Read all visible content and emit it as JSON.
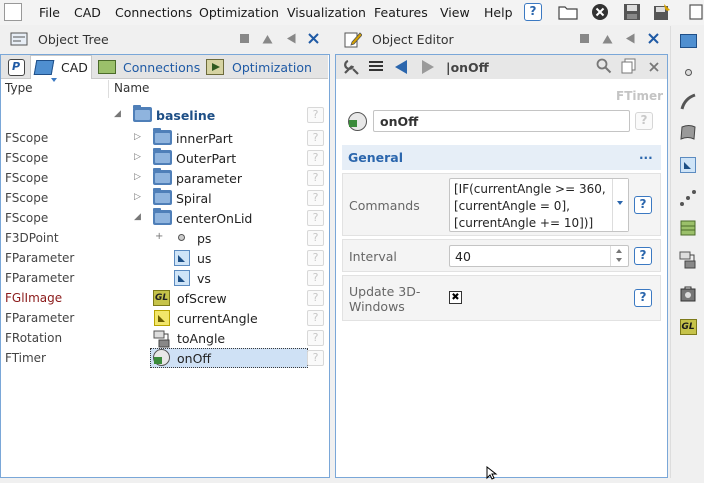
{
  "menubar": {
    "items": [
      "File",
      "CAD",
      "Connections",
      "Optimization",
      "Visualization",
      "Features",
      "View",
      "Help"
    ]
  },
  "tree_panel": {
    "title": "Object Tree",
    "tabs": [
      {
        "label": "P"
      },
      {
        "label": "CAD"
      },
      {
        "label": "Connections"
      },
      {
        "label": "Optimization"
      }
    ],
    "col_type": "Type",
    "col_name": "Name",
    "help_mark": "?",
    "rows": [
      {
        "type": "",
        "name": "baseline",
        "icon": "folder-icon"
      },
      {
        "type": "FScope",
        "name": "innerPart",
        "icon": "folder-icon"
      },
      {
        "type": "FScope",
        "name": "OuterPart",
        "icon": "folder-icon"
      },
      {
        "type": "FScope",
        "name": "parameter",
        "icon": "folder-icon"
      },
      {
        "type": "FScope",
        "name": "Spiral",
        "icon": "folder-icon"
      },
      {
        "type": "FScope",
        "name": "centerOnLid",
        "icon": "folder-icon"
      },
      {
        "type": "F3DPoint",
        "name": "ps",
        "icon": "point-icon"
      },
      {
        "type": "FParameter",
        "name": "us",
        "icon": "parameter-icon"
      },
      {
        "type": "FParameter",
        "name": "vs",
        "icon": "parameter-icon"
      },
      {
        "type": "FGlImage",
        "name": "ofScrew",
        "icon": "gl-image-icon"
      },
      {
        "type": "FParameter",
        "name": "currentAngle",
        "icon": "parameter-icon"
      },
      {
        "type": "FRotation",
        "name": "toAngle",
        "icon": "rotation-icon"
      },
      {
        "type": "FTimer",
        "name": "onOff",
        "icon": "timer-icon"
      }
    ]
  },
  "editor_panel": {
    "title": "Object Editor",
    "path": "|onOff",
    "object_type": "FTimer",
    "object_name": "onOff",
    "section_title": "General",
    "section_more": "...",
    "commands_label": "Commands",
    "commands_lines": [
      "[IF(currentAngle >= 360,",
      "[currentAngle = 0],",
      "[currentAngle += 10])]"
    ],
    "interval_label": "Interval",
    "interval_value": "40",
    "update_label_1": "Update 3D-",
    "update_label_2": "Windows",
    "update_checked": "✖",
    "help_mark": "?"
  },
  "colors": {
    "accent": "#3b79c2",
    "section_bg": "#e6eef7",
    "type_red": "#8b1a1a"
  }
}
